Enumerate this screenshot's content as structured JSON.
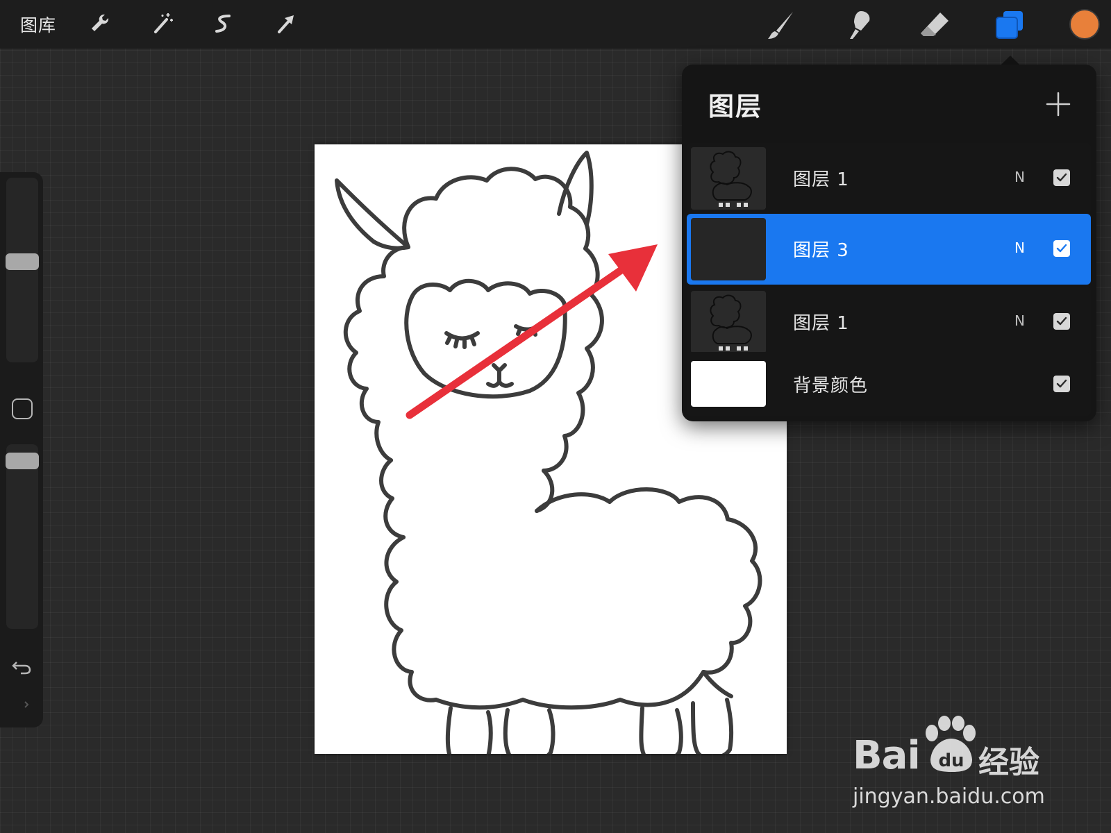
{
  "toolbar": {
    "gallery_label": "图库",
    "left_tools": [
      "wrench-icon",
      "magic-wand-icon",
      "selection-s-icon",
      "transform-arrow-icon"
    ],
    "right_tools": [
      "brush-icon",
      "smudge-icon",
      "eraser-icon",
      "layers-icon"
    ],
    "active_tool": "layers-icon",
    "current_color": "#e8803a",
    "layers_accent": "#1a78f0"
  },
  "sidebar": {
    "brush_size_level": 0.55,
    "opacity_level": 0.95,
    "icons": [
      "modify-square-icon",
      "undo-icon",
      "redo-icon"
    ]
  },
  "layers_panel": {
    "title": "图层",
    "add_icon": "plus-icon",
    "layers": [
      {
        "name": "图层 1",
        "blend": "N",
        "visible": true,
        "selected": false,
        "thumb": "llama-sketch"
      },
      {
        "name": "图层 3",
        "blend": "N",
        "visible": true,
        "selected": true,
        "thumb": "empty-dark"
      },
      {
        "name": "图层 1",
        "blend": "N",
        "visible": true,
        "selected": false,
        "thumb": "llama-sketch"
      },
      {
        "name": "背景颜色",
        "blend": "",
        "visible": true,
        "selected": false,
        "thumb": "white"
      }
    ]
  },
  "annotation": {
    "arrow_color": "#e8303a"
  },
  "watermark": {
    "logo_text": "Bai",
    "logo_paw_text": "du",
    "logo_cn": "经验",
    "url": "jingyan.baidu.com"
  }
}
